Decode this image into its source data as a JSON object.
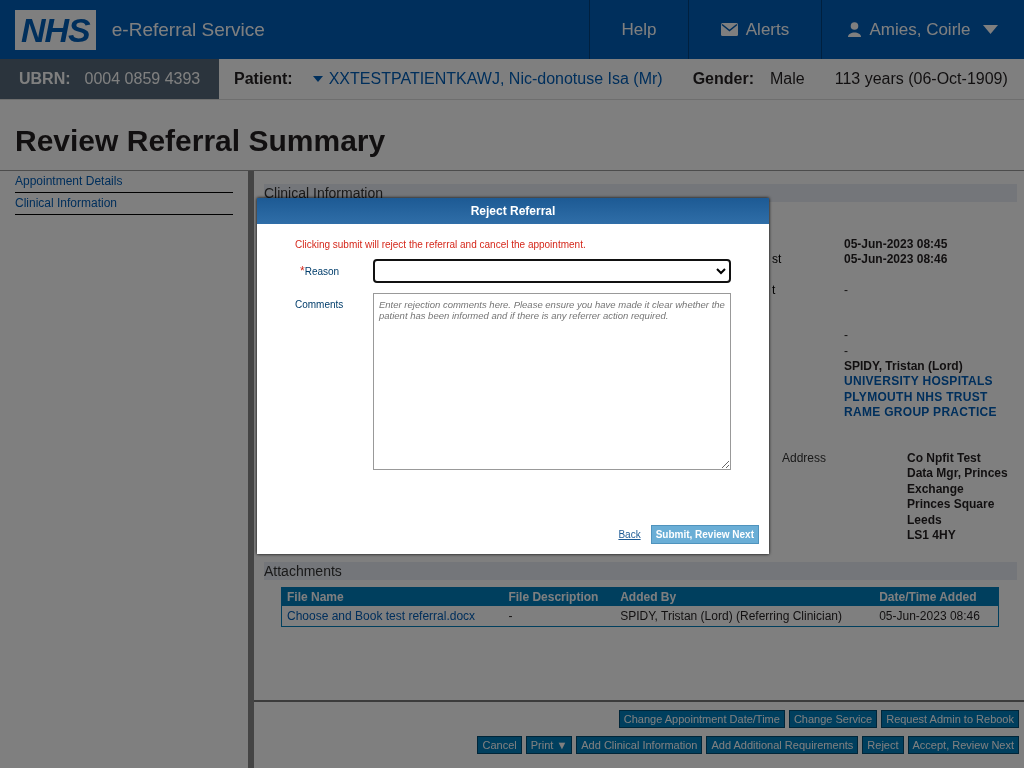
{
  "header": {
    "logo": "NHS",
    "service": "e-Referral Service",
    "nav": [
      {
        "kind": "text",
        "label": "Help"
      },
      {
        "kind": "alerts",
        "label": "Alerts"
      },
      {
        "kind": "user",
        "label": "Amies, Coirle"
      }
    ]
  },
  "patient_bar": {
    "ubrn_label": "UBRN:",
    "ubrn": "0004 0859 4393",
    "patient_label": "Patient:",
    "patient": "XXTESTPATIENTKAWJ, Nic-donotuse Isa (Mr)",
    "gender_label": "Gender:",
    "gender": "Male",
    "age": "113 years (06-Oct-1909)"
  },
  "page_title": "Review Referral Summary",
  "sidebar": {
    "items": [
      {
        "label": "Appointment Details"
      },
      {
        "label": "Clinical Information"
      }
    ]
  },
  "clinical_section": {
    "title": "Clinical Information",
    "rows": [
      {
        "value": "05-Jun-2023 08:45",
        "kind": "bold"
      },
      {
        "label": "st",
        "value": "05-Jun-2023 08:46",
        "kind": "bold"
      },
      {
        "label": "t",
        "value": "-",
        "kind": "plain"
      },
      {
        "value": "-",
        "kind": "plain"
      },
      {
        "value": "-",
        "kind": "plain"
      },
      {
        "value": "SPIDY, Tristan (Lord)",
        "kind": "bold"
      },
      {
        "value": "UNIVERSITY HOSPITALS",
        "kind": "link"
      },
      {
        "value": "PLYMOUTH NHS TRUST",
        "kind": "link"
      },
      {
        "value": "RAME GROUP PRACTICE",
        "kind": "link"
      }
    ],
    "address_label": "Address",
    "address": [
      "Co Npfit Test",
      "Data Mgr, Princes",
      "Exchange",
      "Princes Square",
      "Leeds",
      "LS1 4HY"
    ]
  },
  "attachments": {
    "title": "Attachments",
    "columns": [
      "File Name",
      "File Description",
      "Added By",
      "Date/Time Added"
    ],
    "rows": [
      [
        "Choose and Book test referral.docx",
        "-",
        "SPIDY, Tristan (Lord) (Referring Clinician)",
        "05-Jun-2023 08:46"
      ]
    ]
  },
  "action_rows": [
    [
      "Change Appointment Date/Time",
      "Change Service",
      "Request Admin to Rebook"
    ],
    [
      "Cancel",
      "Print ▼",
      "Add Clinical Information",
      "Add Additional Requirements",
      "Reject",
      "Accept, Review Next"
    ]
  ],
  "dialog": {
    "title": "Reject Referral",
    "warning": "Clicking submit will reject the referral and cancel the appointment.",
    "reason_label": "Reason",
    "required_mark": "*",
    "comments_label": "Comments",
    "comments_placeholder": "Enter rejection comments here. Please ensure you have made it clear whether the patient has been informed and if there is any referrer action required.",
    "back": "Back",
    "submit": "Submit, Review Next"
  }
}
